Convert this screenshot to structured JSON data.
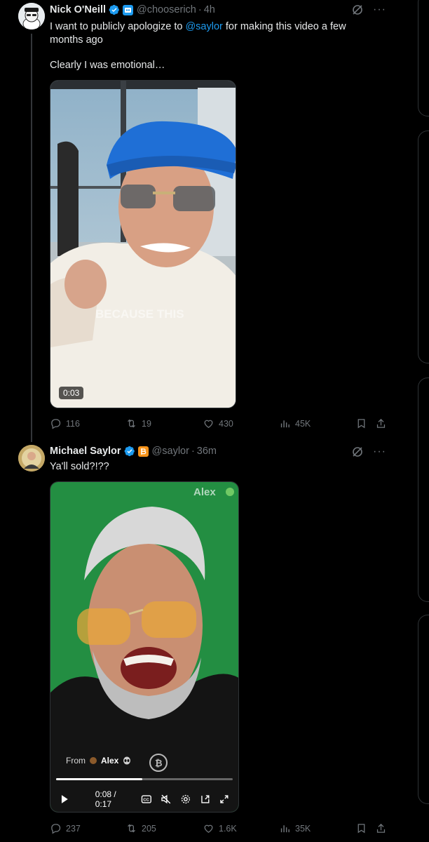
{
  "tweet1": {
    "name": "Nick O'Neill",
    "handle": "@chooserich",
    "time": "4h",
    "text_before": "I want to publicly apologize to ",
    "mention": "@saylor",
    "text_after": " for making this video a few months ago",
    "text_line2": "Clearly I was emotional…",
    "video_time": "0:03",
    "caption_overlay": "BECAUSE THIS",
    "stats": {
      "replies": "116",
      "retweets": "19",
      "likes": "430",
      "views": "45K"
    }
  },
  "tweet2": {
    "name": "Michael Saylor",
    "handle": "@saylor",
    "time": "36m",
    "text": "Ya'll sold?!??",
    "watermark": "Alex",
    "from_label": "From",
    "from_name": "Alex",
    "video_time": "0:08 / 0:17",
    "progress": 0.49,
    "stats": {
      "replies": "237",
      "retweets": "205",
      "likes": "1.6K",
      "views": "35K"
    }
  },
  "colors": {
    "accent": "#1d9bf0",
    "muted": "#71767b",
    "bitcoin": "#f7931a",
    "background": "#000000"
  }
}
